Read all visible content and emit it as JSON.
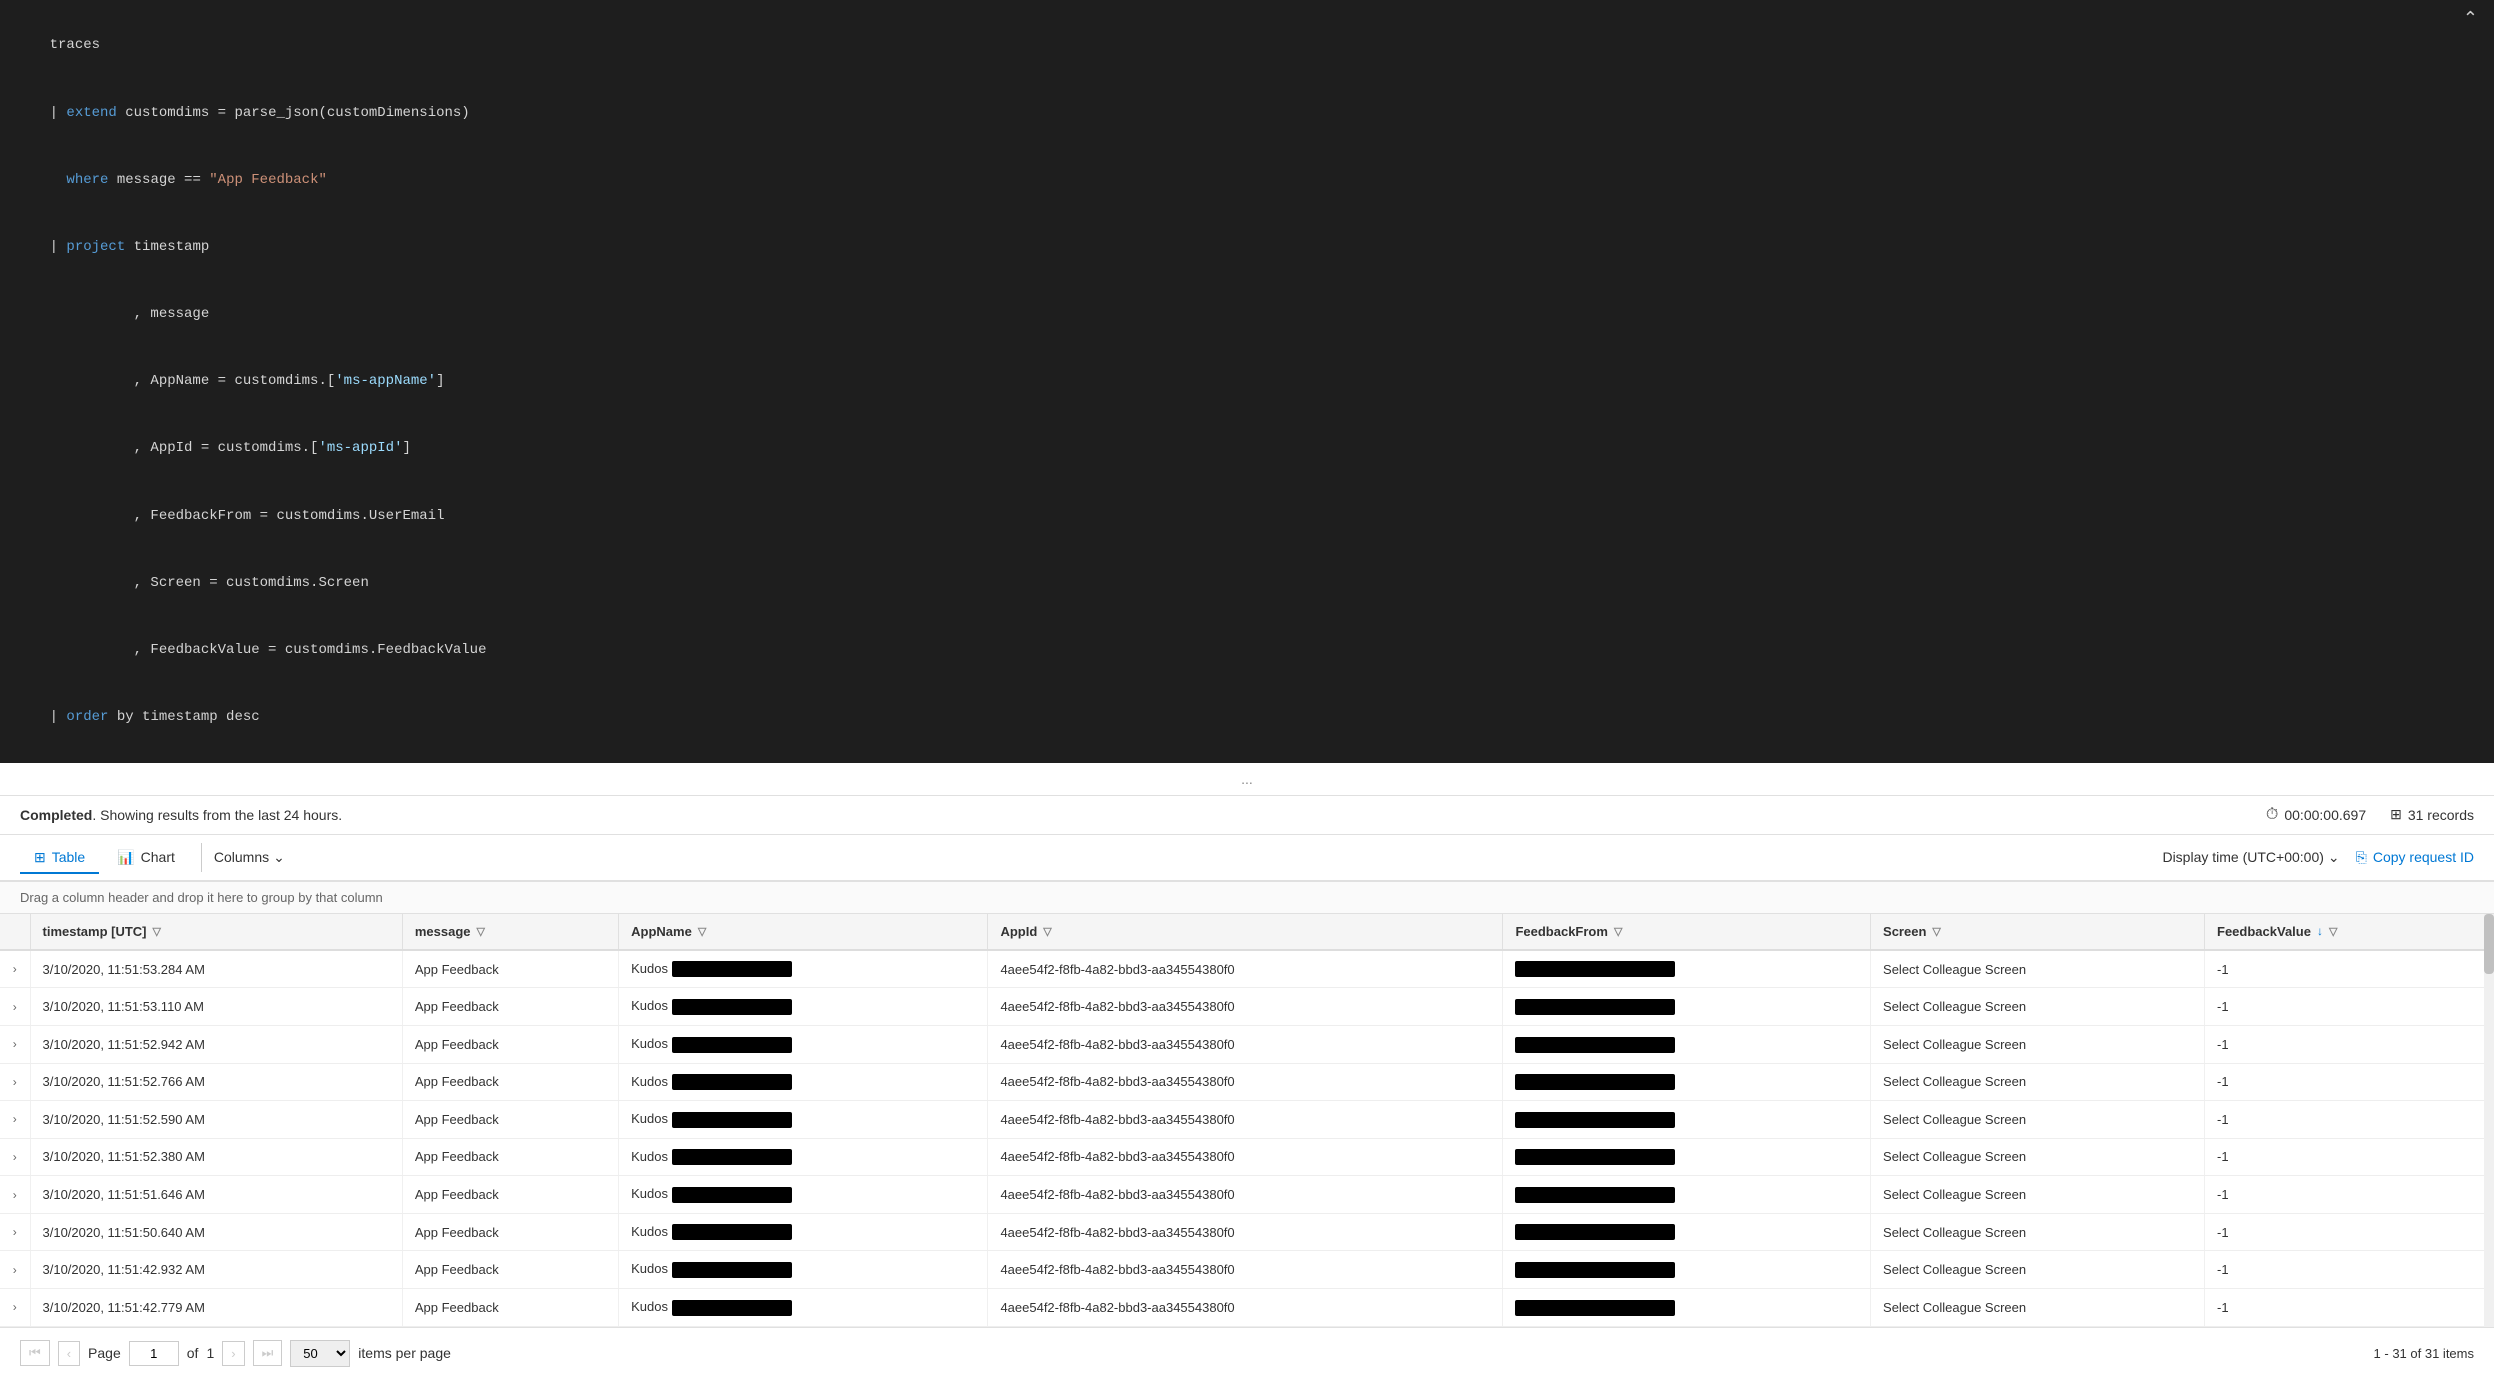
{
  "query": {
    "lines": [
      {
        "text": "traces",
        "color": "white"
      },
      {
        "prefix": "| ",
        "keyword": "extend",
        "rest": " customdims = parse_json(customDimensions)",
        "kw_color": "blue"
      },
      {
        "prefix": "  ",
        "keyword": "where",
        "rest": " message == ",
        "kw_color": "blue",
        "string": "\"App Feedback\""
      },
      {
        "prefix": "| ",
        "keyword": "project",
        "rest": " timestamp",
        "kw_color": "blue"
      },
      {
        "prefix": "          , ",
        "rest": "message"
      },
      {
        "prefix": "          , ",
        "rest": "AppName = customdims.[",
        "prop": "'ms-appName'",
        "rest2": "]"
      },
      {
        "prefix": "          , ",
        "rest": "AppId = customdims.[",
        "prop": "'ms-appId'",
        "rest2": "]"
      },
      {
        "prefix": "          , ",
        "rest": "FeedbackFrom = customdims.UserEmail"
      },
      {
        "prefix": "          , ",
        "rest": "Screen = customdims.Screen"
      },
      {
        "prefix": "          , ",
        "rest": "FeedbackValue = customdims.FeedbackValue"
      },
      {
        "prefix": "| ",
        "keyword": "order",
        "rest": " by timestamp desc",
        "kw_color": "blue"
      }
    ]
  },
  "status": {
    "message": "Completed",
    "detail": ". Showing results from the last 24 hours.",
    "time": "00:00:00.697",
    "records": "31 records"
  },
  "toolbar": {
    "table_tab": "Table",
    "chart_tab": "Chart",
    "columns_btn": "Columns",
    "display_time": "Display time (UTC+00:00)",
    "copy_request": "Copy request ID"
  },
  "drag_hint": "Drag a column header and drop it here to group by that column",
  "columns": [
    {
      "label": "timestamp [UTC]",
      "filter": true,
      "sort": null
    },
    {
      "label": "message",
      "filter": true,
      "sort": null
    },
    {
      "label": "AppName",
      "filter": true,
      "sort": null
    },
    {
      "label": "AppId",
      "filter": true,
      "sort": null
    },
    {
      "label": "FeedbackFrom",
      "filter": true,
      "sort": null
    },
    {
      "label": "Screen",
      "filter": true,
      "sort": null
    },
    {
      "label": "FeedbackValue",
      "filter": true,
      "sort": "desc"
    }
  ],
  "rows": [
    {
      "timestamp": "3/10/2020, 11:51:53.284 AM",
      "message": "App Feedback",
      "appName": "Kudos",
      "appId": "4aee54f2-f8fb-4a82-bbd3-aa34554380f0",
      "feedbackFrom": "REDACTED",
      "screen": "Select Colleague Screen",
      "feedbackValue": "-1"
    },
    {
      "timestamp": "3/10/2020, 11:51:53.110 AM",
      "message": "App Feedback",
      "appName": "Kudos",
      "appId": "4aee54f2-f8fb-4a82-bbd3-aa34554380f0",
      "feedbackFrom": "REDACTED",
      "screen": "Select Colleague Screen",
      "feedbackValue": "-1"
    },
    {
      "timestamp": "3/10/2020, 11:51:52.942 AM",
      "message": "App Feedback",
      "appName": "Kudos",
      "appId": "4aee54f2-f8fb-4a82-bbd3-aa34554380f0",
      "feedbackFrom": "REDACTED",
      "screen": "Select Colleague Screen",
      "feedbackValue": "-1"
    },
    {
      "timestamp": "3/10/2020, 11:51:52.766 AM",
      "message": "App Feedback",
      "appName": "Kudos",
      "appId": "4aee54f2-f8fb-4a82-bbd3-aa34554380f0",
      "feedbackFrom": "REDACTED",
      "screen": "Select Colleague Screen",
      "feedbackValue": "-1"
    },
    {
      "timestamp": "3/10/2020, 11:51:52.590 AM",
      "message": "App Feedback",
      "appName": "Kudos",
      "appId": "4aee54f2-f8fb-4a82-bbd3-aa34554380f0",
      "feedbackFrom": "REDACTED",
      "screen": "Select Colleague Screen",
      "feedbackValue": "-1"
    },
    {
      "timestamp": "3/10/2020, 11:51:52.380 AM",
      "message": "App Feedback",
      "appName": "Kudos",
      "appId": "4aee54f2-f8fb-4a82-bbd3-aa34554380f0",
      "feedbackFrom": "REDACTED",
      "screen": "Select Colleague Screen",
      "feedbackValue": "-1"
    },
    {
      "timestamp": "3/10/2020, 11:51:51.646 AM",
      "message": "App Feedback",
      "appName": "Kudos",
      "appId": "4aee54f2-f8fb-4a82-bbd3-aa34554380f0",
      "feedbackFrom": "REDACTED",
      "screen": "Select Colleague Screen",
      "feedbackValue": "-1"
    },
    {
      "timestamp": "3/10/2020, 11:51:50.640 AM",
      "message": "App Feedback",
      "appName": "Kudos",
      "appId": "4aee54f2-f8fb-4a82-bbd3-aa34554380f0",
      "feedbackFrom": "REDACTED",
      "screen": "Select Colleague Screen",
      "feedbackValue": "-1"
    },
    {
      "timestamp": "3/10/2020, 11:51:42.932 AM",
      "message": "App Feedback",
      "appName": "Kudos",
      "appId": "4aee54f2-f8fb-4a82-bbd3-aa34554380f0",
      "feedbackFrom": "REDACTED",
      "screen": "Select Colleague Screen",
      "feedbackValue": "-1"
    },
    {
      "timestamp": "3/10/2020, 11:51:42.779 AM",
      "message": "App Feedback",
      "appName": "Kudos",
      "appId": "4aee54f2-f8fb-4a82-bbd3-aa34554380f0",
      "feedbackFrom": "REDACTED",
      "screen": "Select Colleague Screen",
      "feedbackValue": "-1"
    }
  ],
  "pagination": {
    "page_label": "Page",
    "current_page": "1",
    "of_label": "of",
    "total_pages": "1",
    "per_page": "50",
    "items_label": "items per page",
    "range_label": "1 - 31 of 31 items"
  }
}
